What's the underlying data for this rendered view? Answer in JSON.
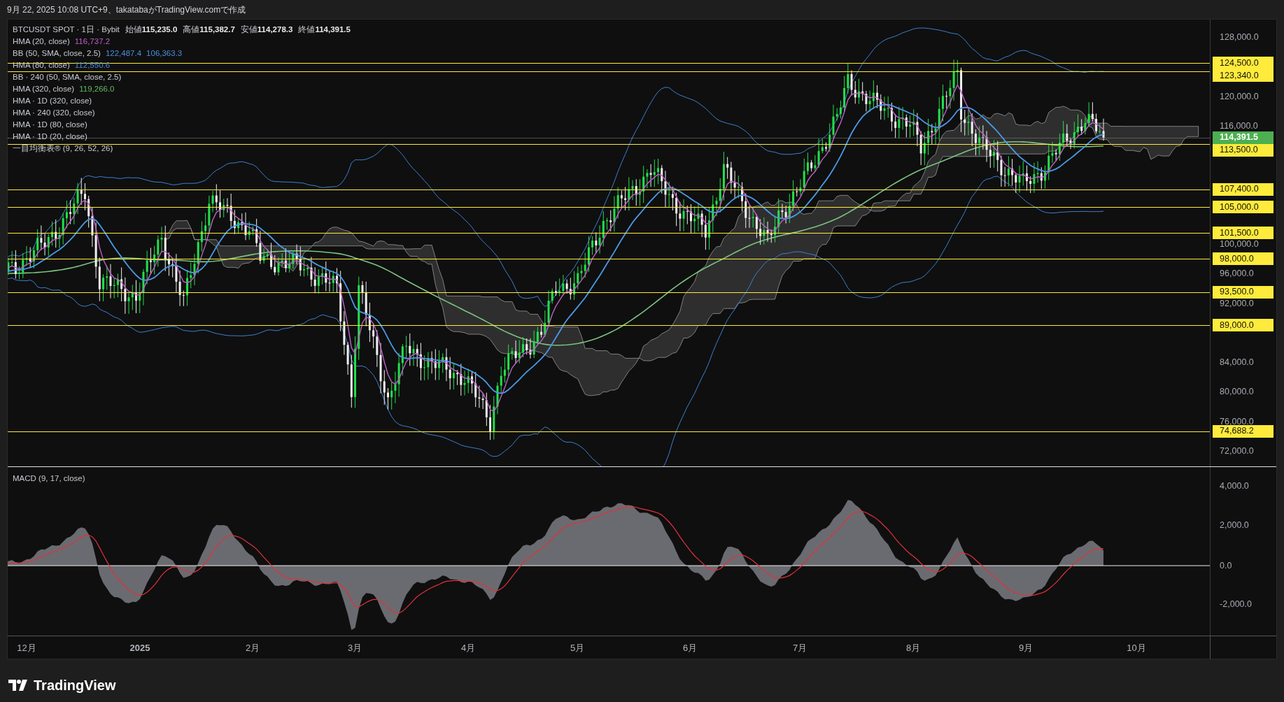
{
  "header": {
    "caption": "9月 22, 2025 10:08 UTC+9、takatabaがTradingView.comで作成"
  },
  "chart": {
    "legend": {
      "symbol": "BTCUSDT SPOT · 1日 · Bybit",
      "ohlc": [
        {
          "label": "始値",
          "value": "115,235.0"
        },
        {
          "label": "高値",
          "value": "115,382.7"
        },
        {
          "label": "安値",
          "value": "114,278.3"
        },
        {
          "label": "終値",
          "value": "114,391.5"
        }
      ],
      "indicators": [
        {
          "label": "HMA (20, close)",
          "values": [
            "116,737.2"
          ],
          "color": "#c05ec8"
        },
        {
          "label": "BB (50, SMA, close, 2.5)",
          "values": [
            "122,487.4",
            "106,363.3"
          ],
          "color": "#4a8fe0"
        },
        {
          "label": "HMA (80, close)",
          "values": [
            "112,550.6"
          ],
          "color": "#4a8fe0"
        },
        {
          "label": "BB · 240 (50, SMA, close, 2.5)"
        },
        {
          "label": "HMA (320, close)",
          "values": [
            "119,266.0"
          ],
          "color": "#62b866"
        },
        {
          "label": "HMA · 1D (320, close)"
        },
        {
          "label": "HMA · 240 (320, close)"
        },
        {
          "label": "HMA · 1D (80, close)"
        },
        {
          "label": "HMA · 1D (20, close)"
        },
        {
          "label": "一目均衡表® (9, 26, 52, 26)"
        }
      ]
    },
    "price_axis": {
      "ticks": [
        "128,000.0",
        "120,000.0",
        "116,000.0",
        "100,000.0",
        "96,000.0",
        "92,000.0",
        "84,000.0",
        "80,000.0",
        "76,000.0",
        "72,000.0"
      ]
    },
    "price_levels": [
      {
        "label": "124,500.0"
      },
      {
        "label": "123,340.0"
      },
      {
        "label": "113,500.0"
      },
      {
        "label": "107,400.0"
      },
      {
        "label": "105,000.0"
      },
      {
        "label": "101,500.0"
      },
      {
        "label": "98,000.0"
      },
      {
        "label": "93,500.0"
      },
      {
        "label": "89,000.0"
      },
      {
        "label": "74,688.2"
      }
    ],
    "last_price": {
      "label": "114,391.5"
    },
    "macd": {
      "title": "MACD (9, 17, close)",
      "ticks": [
        "4,000.0",
        "2,000.0",
        "0.0",
        "-2,000.0"
      ]
    },
    "time_axis": {
      "labels": [
        {
          "text": "12月",
          "kind": "month"
        },
        {
          "text": "2025",
          "kind": "year"
        },
        {
          "text": "2月",
          "kind": "month"
        },
        {
          "text": "3月",
          "kind": "month"
        },
        {
          "text": "4月",
          "kind": "month"
        },
        {
          "text": "5月",
          "kind": "month"
        },
        {
          "text": "6月",
          "kind": "month"
        },
        {
          "text": "7月",
          "kind": "month"
        },
        {
          "text": "8月",
          "kind": "month"
        },
        {
          "text": "9月",
          "kind": "month"
        },
        {
          "text": "10月",
          "kind": "month"
        }
      ]
    }
  },
  "footer": {
    "brand": "TradingView"
  }
}
